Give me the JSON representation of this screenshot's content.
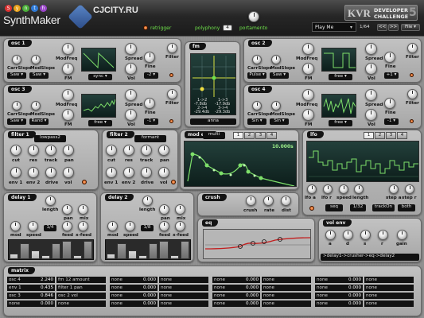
{
  "header": {
    "logo_letters": [
      "S",
      "y",
      "n",
      "t",
      "h"
    ],
    "logo_text": "SynthMaker",
    "site": "CJCITY.RU",
    "retrigger": "retrigger",
    "polyphony_label": "polyphony",
    "polyphony_value": "4",
    "portamento": "portamento",
    "preset": "Play Me",
    "preset_counter": "1/64",
    "nav_prev": "<<",
    "nav_next": ">>",
    "file": "File",
    "kvr": "KVR",
    "challenge_line1": "DEVELOPER",
    "challenge_line2": "CHALLENGE",
    "challenge_num": "5"
  },
  "osc1": {
    "title": "osc 1",
    "carrslope": "CarrSlope",
    "modslope": "ModSlope",
    "modfreq": "ModFreq",
    "carr_wave": "Saw",
    "mod_wave": "Saw",
    "fm": "FM",
    "sync": "sync",
    "spread": "Spread",
    "vol": "Vol",
    "fine": "Fine",
    "fine_val": "-2",
    "filter": "Filter"
  },
  "osc2": {
    "title": "osc 2",
    "carrslope": "CarrSlope",
    "modslope": "ModSlope",
    "modfreq": "ModFreq",
    "carr_wave": "Pulse",
    "mod_wave": "Saw",
    "fm": "FM",
    "mode": "free",
    "spread": "Spread",
    "vol": "Vol",
    "fine": "Fine",
    "fine_val": "+1",
    "filter": "Filter"
  },
  "osc3": {
    "title": "osc 3",
    "carrslope": "CarrSlope",
    "modslope": "ModSlope",
    "modfreq": "ModFreq",
    "carr_wave": "Saw",
    "mod_wave": "Rand",
    "fm": "FM",
    "mode": "free",
    "spread": "Spread",
    "vol": "Vol",
    "fine": "Fine",
    "fine_val": "-1",
    "filter": "Filter"
  },
  "osc4": {
    "title": "osc 4",
    "carrslope": "CarrSlope",
    "modslope": "ModSlope",
    "modfreq": "ModFreq",
    "carr_wave": "Sin",
    "mod_wave": "Sin",
    "fm": "FM",
    "mode": "free",
    "spread": "Spread",
    "vol": "Vol",
    "fine": "Fine",
    "fine_val": "-1",
    "filter": "Filter"
  },
  "fm": {
    "title": "fm",
    "lines": [
      "1->2",
      "1->3",
      "-7.8db",
      "-17.9db",
      "2->4",
      "3->4",
      "-29.4db",
      "-29.3db"
    ],
    "name": "anna"
  },
  "filter1": {
    "title": "filter 1",
    "type": "lowpass2",
    "cut": "cut",
    "res": "res",
    "track": "track",
    "pan": "pan",
    "env1": "env 1",
    "env2": "env 2",
    "drive": "drive",
    "vol": "vol"
  },
  "filter2": {
    "title": "filter 2",
    "type": "formant",
    "cut": "cut",
    "res": "res",
    "track": "track",
    "pan": "pan",
    "env1": "env 1",
    "env2": "env 2",
    "drive": "drive",
    "vol": "vol"
  },
  "modenv": {
    "title": "mod env",
    "mode": "multi",
    "tabs": [
      "1",
      "2",
      "3",
      "4"
    ],
    "time": "10.000s"
  },
  "lfo": {
    "title": "lfo",
    "tabs": [
      "1",
      "2",
      "3",
      "4"
    ],
    "lfoa": "lfo a",
    "lfor": "lfo r",
    "speed": "speed",
    "length": "length",
    "seq": "seq",
    "length_val": "1/32",
    "trackon": "trackOn",
    "both": "both",
    "stepa": "step a",
    "stepr": "step r"
  },
  "delay1": {
    "title": "delay 1",
    "length": "length",
    "pan": "pan",
    "mix": "mix",
    "mod": "mod",
    "speed": "speed",
    "length_val": "1/4",
    "feed": "feed",
    "xfeed": "x-feed",
    "bars": [
      0.3,
      0.85,
      0.45,
      0.2,
      0.85,
      0.95,
      0.2,
      0.95
    ],
    "bar_states": [
      0,
      1,
      0,
      0,
      1,
      1,
      0,
      1
    ]
  },
  "delay2": {
    "title": "delay 2",
    "length": "length",
    "pan": "pan",
    "mix": "mix",
    "mod": "mod",
    "speed": "speed",
    "length_val": "1/8",
    "feed": "feed",
    "xfeed": "x-feed",
    "bars": [
      0.3,
      0.85,
      0.45,
      0.2,
      0.85,
      0.95,
      0.2,
      0.95
    ],
    "bar_states": [
      0,
      1,
      0,
      0,
      1,
      1,
      0,
      1
    ]
  },
  "crush": {
    "title": "crush",
    "crush": "crush",
    "rate": "rate",
    "dist": "dist"
  },
  "eq": {
    "title": "eq"
  },
  "volenv": {
    "title": "vol env",
    "a": "a",
    "d": "d",
    "s": "s",
    "r": "r",
    "gain": "gain",
    "routing": ">delay1->crusher->eq->delay2"
  },
  "matrix": {
    "title": "matrix",
    "rows": [
      [
        [
          "osc 4",
          "2.240"
        ],
        [
          "fm 12 amount",
          ""
        ],
        [
          "none",
          "0.000"
        ],
        [
          "none",
          ""
        ],
        [
          "none",
          "0.000"
        ],
        [
          "none",
          ""
        ],
        [
          "none",
          "0.000"
        ],
        [
          "none",
          ""
        ]
      ],
      [
        [
          "env 1",
          "0.435"
        ],
        [
          "filter 1 pan",
          ""
        ],
        [
          "none",
          "0.000"
        ],
        [
          "none",
          ""
        ],
        [
          "none",
          "0.000"
        ],
        [
          "none",
          ""
        ],
        [
          "none",
          "0.000"
        ],
        [
          "none",
          ""
        ]
      ],
      [
        [
          "osc 3",
          "0.846"
        ],
        [
          "osc 2 vol",
          ""
        ],
        [
          "none",
          "0.000"
        ],
        [
          "none",
          ""
        ],
        [
          "none",
          "0.000"
        ],
        [
          "none",
          ""
        ],
        [
          "none",
          "0.000"
        ],
        [
          "none",
          ""
        ]
      ],
      [
        [
          "none",
          "0.000"
        ],
        [
          "none",
          ""
        ],
        [
          "none",
          "0.000"
        ],
        [
          "none",
          ""
        ],
        [
          "none",
          "0.000"
        ],
        [
          "none",
          ""
        ],
        [
          "none",
          "0.000"
        ],
        [
          "none",
          ""
        ]
      ]
    ]
  },
  "colors": {
    "accent_green": "#60e040",
    "led_orange": "#e8741a",
    "screen": "#16302c"
  }
}
